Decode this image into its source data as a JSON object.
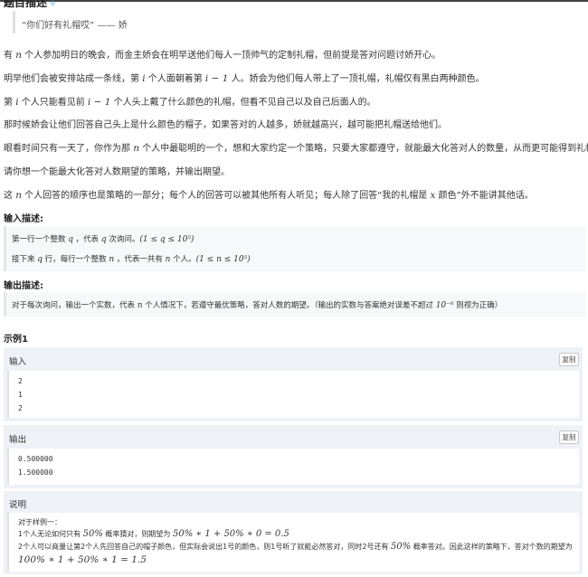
{
  "section_title": "题目描述",
  "quote": "“你们好有礼帽哎” —— 娇",
  "description": {
    "p1": {
      "a": "有 ",
      "n": "n",
      "b": " 个人参加明日的晚会，而金主娇会在明早送他们每人一顶帅气的定制礼帽，但前提是答对问题讨娇开心。"
    },
    "p2": {
      "a": "明早他们会被安排站成一条线，第 ",
      "i": "i",
      "b": " 个人面朝着第 ",
      "expr": "i − 1",
      "c": " 人。娇会为他们每人带上了一顶礼帽，礼帽仅有黑白两种颜色。"
    },
    "p3": {
      "a": "第 ",
      "i": "i",
      "b": " 个人只能看见前 ",
      "expr": "i − 1",
      "c": " 个人头上戴了什么颜色的礼帽，但看不见自己以及自己后面人的。"
    },
    "p4": "那时候娇会让他们回答自己头上是什么颜色的帽子，如果答对的人越多，娇就越高兴，越可能把礼帽送给他们。",
    "p5": {
      "a": "眼看时间只有一天了，你作为那 ",
      "n": "n",
      "b": " 个人中最聪明的一个，想和大家约定一个策略，只要大家都遵守，就能最大化答对人的数量，从而更可能得到礼帽。"
    },
    "p6": "请你想一个能最大化答对人数期望的策略，并输出期望。",
    "p7": {
      "a": "这 ",
      "n": "n",
      "b": " 个人回答的顺序也是策略的一部分；每个人的回答可以被其他所有人听见；每人除了回答“我的礼帽是 ",
      "x": "x",
      "c": " 颜色”外不能讲其他话。"
    }
  },
  "input_desc": {
    "title": "输入描述:",
    "line1": {
      "a": "第一行一个整数 ",
      "q": "q",
      "b": " ，代表 ",
      "q2": "q",
      "c": " 次询问。",
      "range": "(1 ≤ q ≤ 10⁵)"
    },
    "line2": {
      "a": "接下来 ",
      "q": "q",
      "b": " 行，每行一个整数 ",
      "n": "n",
      "c": " ，代表一共有 ",
      "n2": "n",
      "d": " 个人。",
      "range": "(1 ≤ n ≤ 10⁵)"
    }
  },
  "output_desc": {
    "title": "输出描述:",
    "line": {
      "a": "对于每次询问，输出一个实数，代表 ",
      "n": "n",
      "b": " 个人情况下，若遵守最优策略，答对人数的期望。（输出的实数与答案绝对误差不超过 ",
      "eps": "10⁻⁶",
      "c": " 则视为正确）"
    }
  },
  "sample": {
    "title": "示例1",
    "copy_label": "复制",
    "input_label": "输入",
    "input_lines": [
      "2",
      "1",
      "2"
    ],
    "output_label": "输出",
    "output_lines": [
      "0.500000",
      "1.500000"
    ],
    "explain_label": "说明",
    "explain": {
      "l1": "对于样例一：",
      "l2a": "1个人无论如何只有 ",
      "l2pct": "50%",
      "l2b": " 概率猜对，则期望为 ",
      "l2expr": "50% ∗ 1 + 50% ∗ 0 = 0.5",
      "l3a": "2个人可以商量让第2个人先回答自己的帽子颜色，但实际会说出1号的颜色，则1号听了就能必然答对，同时2号还有 ",
      "l3pct": "50%",
      "l3b": " 概率答对。因此这样的策略下，答对个数的期望为",
      "l4expr": "100% ∗ 1 + 50% ∗ 1 = 1.5"
    }
  }
}
